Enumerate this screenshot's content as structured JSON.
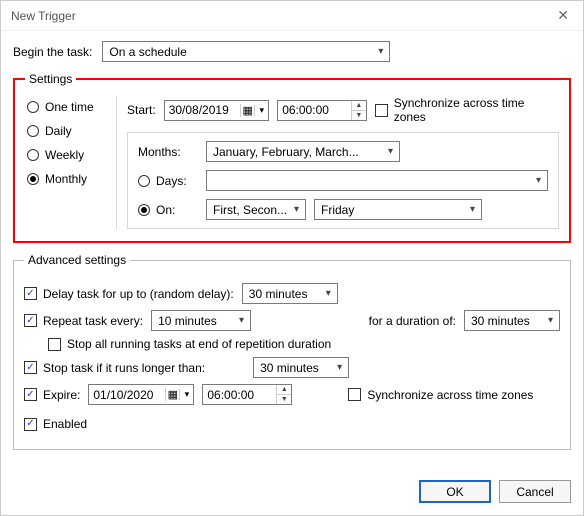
{
  "window": {
    "title": "New Trigger"
  },
  "begin": {
    "label": "Begin the task:",
    "value": "On a schedule"
  },
  "settings": {
    "legend": "Settings",
    "frequency": {
      "options": {
        "one": "One time",
        "daily": "Daily",
        "weekly": "Weekly",
        "monthly": "Monthly"
      },
      "selected": "monthly"
    },
    "start": {
      "label": "Start:",
      "date": "30/08/2019",
      "time": "06:00:00",
      "sync_label": "Synchronize across time zones",
      "sync_checked": false
    },
    "monthly": {
      "months_label": "Months:",
      "months_value": "January, February, March...",
      "days_label": "Days:",
      "days_value": "",
      "on_label": "On:",
      "on_week_value": "First, Secon...",
      "on_day_value": "Friday",
      "mode": "on"
    }
  },
  "advanced": {
    "legend": "Advanced settings",
    "delay": {
      "checked": true,
      "label": "Delay task for up to (random delay):",
      "value": "30 minutes"
    },
    "repeat": {
      "checked": true,
      "label": "Repeat task every:",
      "value": "10 minutes",
      "duration_label": "for a duration of:",
      "duration_value": "30 minutes",
      "stop_end_checked": false,
      "stop_end_label": "Stop all running tasks at end of repetition duration"
    },
    "stop_long": {
      "checked": true,
      "label": "Stop task if it runs longer than:",
      "value": "30 minutes"
    },
    "expire": {
      "checked": true,
      "label": "Expire:",
      "date": "01/10/2020",
      "time": "06:00:00",
      "sync_label": "Synchronize across time zones",
      "sync_checked": false
    },
    "enabled": {
      "checked": true,
      "label": "Enabled"
    }
  },
  "buttons": {
    "ok": "OK",
    "cancel": "Cancel"
  }
}
